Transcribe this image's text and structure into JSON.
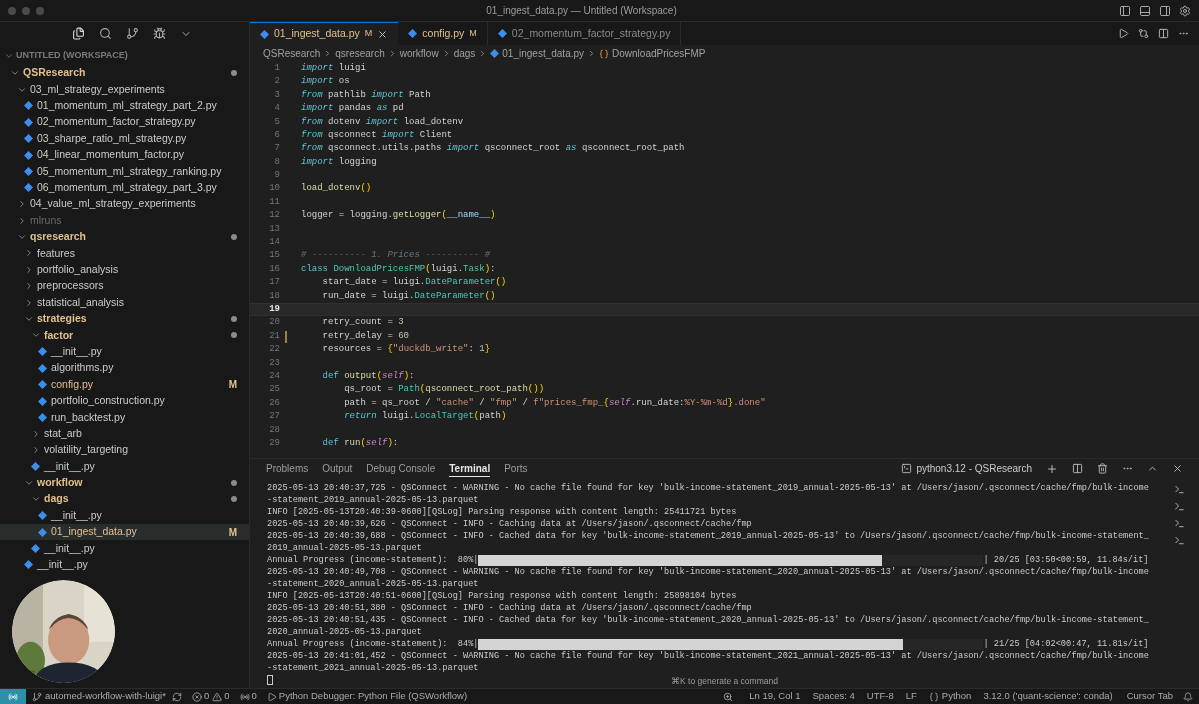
{
  "window": {
    "title": "01_ingest_data.py — Untitled (Workspace)"
  },
  "sidebar": {
    "workspace": "UNTITLED (WORKSPACE)",
    "tree": [
      {
        "name": "QSResearch",
        "kind": "folder",
        "expanded": true,
        "modified": true,
        "ignored": false,
        "selected": false,
        "children": [
          {
            "name": "03_ml_strategy_experiments",
            "kind": "folder",
            "expanded": true,
            "modified": false,
            "ignored": false,
            "selected": false,
            "children": [
              {
                "name": "01_momentum_ml_strategy_part_2.py",
                "kind": "file",
                "modified": false,
                "ignored": false,
                "selected": false
              },
              {
                "name": "02_momentum_factor_strategy.py",
                "kind": "file",
                "modified": false,
                "ignored": false,
                "selected": false
              },
              {
                "name": "03_sharpe_ratio_ml_strategy.py",
                "kind": "file",
                "modified": false,
                "ignored": false,
                "selected": false
              },
              {
                "name": "04_linear_momentum_factor.py",
                "kind": "file",
                "modified": false,
                "ignored": false,
                "selected": false
              },
              {
                "name": "05_momentum_ml_strategy_ranking.py",
                "kind": "file",
                "modified": false,
                "ignored": false,
                "selected": false
              },
              {
                "name": "06_momentum_ml_strategy_part_3.py",
                "kind": "file",
                "modified": false,
                "ignored": false,
                "selected": false
              }
            ]
          },
          {
            "name": "04_value_ml_strategy_experiments",
            "kind": "folder",
            "expanded": false,
            "modified": false,
            "ignored": false,
            "selected": false
          },
          {
            "name": "mlruns",
            "kind": "folder",
            "expanded": false,
            "modified": false,
            "ignored": true,
            "selected": false
          },
          {
            "name": "qsresearch",
            "kind": "folder",
            "expanded": true,
            "modified": true,
            "ignored": false,
            "selected": false,
            "children": [
              {
                "name": "features",
                "kind": "folder",
                "expanded": false,
                "modified": false,
                "ignored": false,
                "selected": false
              },
              {
                "name": "portfolio_analysis",
                "kind": "folder",
                "expanded": false,
                "modified": false,
                "ignored": false,
                "selected": false
              },
              {
                "name": "preprocessors",
                "kind": "folder",
                "expanded": false,
                "modified": false,
                "ignored": false,
                "selected": false
              },
              {
                "name": "statistical_analysis",
                "kind": "folder",
                "expanded": false,
                "modified": false,
                "ignored": false,
                "selected": false
              },
              {
                "name": "strategies",
                "kind": "folder",
                "expanded": true,
                "modified": true,
                "ignored": false,
                "selected": false,
                "children": [
                  {
                    "name": "factor",
                    "kind": "folder",
                    "expanded": true,
                    "modified": true,
                    "ignored": false,
                    "selected": false,
                    "children": [
                      {
                        "name": "__init__.py",
                        "kind": "file",
                        "modified": false,
                        "ignored": false,
                        "selected": false
                      },
                      {
                        "name": "algorithms.py",
                        "kind": "file",
                        "modified": false,
                        "ignored": false,
                        "selected": false
                      },
                      {
                        "name": "config.py",
                        "kind": "file",
                        "modified": true,
                        "ignored": false,
                        "badge": "M",
                        "selected": false
                      },
                      {
                        "name": "portfolio_construction.py",
                        "kind": "file",
                        "modified": false,
                        "ignored": false,
                        "selected": false
                      },
                      {
                        "name": "run_backtest.py",
                        "kind": "file",
                        "modified": false,
                        "ignored": false,
                        "selected": false
                      }
                    ]
                  },
                  {
                    "name": "stat_arb",
                    "kind": "folder",
                    "expanded": false,
                    "modified": false,
                    "ignored": false,
                    "selected": false
                  },
                  {
                    "name": "volatility_targeting",
                    "kind": "folder",
                    "expanded": false,
                    "modified": false,
                    "ignored": false,
                    "selected": false
                  },
                  {
                    "name": "__init__.py",
                    "kind": "file",
                    "modified": false,
                    "ignored": false,
                    "selected": false
                  }
                ]
              },
              {
                "name": "workflow",
                "kind": "folder",
                "expanded": true,
                "modified": true,
                "ignored": false,
                "selected": false,
                "children": [
                  {
                    "name": "dags",
                    "kind": "folder",
                    "expanded": true,
                    "modified": true,
                    "ignored": false,
                    "selected": false,
                    "children": [
                      {
                        "name": "__init__.py",
                        "kind": "file",
                        "modified": false,
                        "ignored": false,
                        "selected": false
                      },
                      {
                        "name": "01_ingest_data.py",
                        "kind": "file",
                        "modified": true,
                        "ignored": false,
                        "badge": "M",
                        "selected": true
                      }
                    ]
                  },
                  {
                    "name": "__init__.py",
                    "kind": "file",
                    "modified": false,
                    "ignored": false,
                    "selected": false
                  }
                ]
              },
              {
                "name": "__init__.py",
                "kind": "file",
                "modified": false,
                "ignored": false,
                "selected": false
              }
            ]
          }
        ]
      }
    ]
  },
  "editor": {
    "tabs": [
      {
        "label": "01_ingest_data.py",
        "badge": "M",
        "modified": true,
        "dimmed": false,
        "selected": true
      },
      {
        "label": "config.py",
        "badge": "M",
        "modified": true,
        "dimmed": false,
        "selected": false
      },
      {
        "label": "02_momentum_factor_strategy.py",
        "modified": false,
        "dimmed": true,
        "selected": false
      }
    ],
    "breadcrumb": [
      "QSResearch",
      "qsresearch",
      "workflow",
      "dags",
      "01_ingest_data.py",
      "DownloadPricesFMP"
    ],
    "lines": [
      {
        "n": "1",
        "current": false,
        "changed": false,
        "tokens": [
          {
            "kind": "kw",
            "t": "import"
          },
          {
            "kind": "plain",
            "t": " luigi"
          }
        ]
      },
      {
        "n": "2",
        "current": false,
        "changed": false,
        "tokens": [
          {
            "kind": "kw",
            "t": "import"
          },
          {
            "kind": "plain",
            "t": " os"
          }
        ]
      },
      {
        "n": "3",
        "current": false,
        "changed": false,
        "tokens": [
          {
            "kind": "kw",
            "t": "from"
          },
          {
            "kind": "plain",
            "t": " pathlib "
          },
          {
            "kind": "kw",
            "t": "import"
          },
          {
            "kind": "plain",
            "t": " Path"
          }
        ]
      },
      {
        "n": "4",
        "current": false,
        "changed": false,
        "tokens": [
          {
            "kind": "kw",
            "t": "import"
          },
          {
            "kind": "plain",
            "t": " pandas "
          },
          {
            "kind": "kw",
            "t": "as"
          },
          {
            "kind": "plain",
            "t": " pd"
          }
        ]
      },
      {
        "n": "5",
        "current": false,
        "changed": false,
        "tokens": [
          {
            "kind": "kw",
            "t": "from"
          },
          {
            "kind": "plain",
            "t": " dotenv "
          },
          {
            "kind": "kw",
            "t": "import"
          },
          {
            "kind": "plain",
            "t": " load_dotenv"
          }
        ]
      },
      {
        "n": "6",
        "current": false,
        "changed": false,
        "tokens": [
          {
            "kind": "kw",
            "t": "from"
          },
          {
            "kind": "plain",
            "t": " qsconnect "
          },
          {
            "kind": "kw",
            "t": "import"
          },
          {
            "kind": "plain",
            "t": " Client"
          }
        ]
      },
      {
        "n": "7",
        "current": false,
        "changed": false,
        "tokens": [
          {
            "kind": "kw",
            "t": "from"
          },
          {
            "kind": "plain",
            "t": " qsconnect.utils.paths "
          },
          {
            "kind": "kw",
            "t": "import"
          },
          {
            "kind": "plain",
            "t": " qsconnect_root "
          },
          {
            "kind": "kw",
            "t": "as"
          },
          {
            "kind": "plain",
            "t": " qsconnect_root_path"
          }
        ]
      },
      {
        "n": "8",
        "current": false,
        "changed": false,
        "tokens": [
          {
            "kind": "kw",
            "t": "import"
          },
          {
            "kind": "plain",
            "t": " logging"
          }
        ]
      },
      {
        "n": "9",
        "current": false,
        "changed": false
      },
      {
        "n": "10",
        "current": false,
        "changed": false,
        "tokens": [
          {
            "kind": "fn",
            "t": "load_dotenv"
          },
          {
            "kind": "br",
            "t": "()"
          }
        ]
      },
      {
        "n": "11",
        "current": false,
        "changed": false
      },
      {
        "n": "12",
        "current": false,
        "changed": false,
        "tokens": [
          {
            "kind": "plain",
            "t": "logger = logging."
          },
          {
            "kind": "fn",
            "t": "getLogger"
          },
          {
            "kind": "br",
            "t": "("
          },
          {
            "kind": "var",
            "t": "__name__"
          },
          {
            "kind": "br",
            "t": ")"
          }
        ]
      },
      {
        "n": "13",
        "current": false,
        "changed": false
      },
      {
        "n": "14",
        "current": false,
        "changed": false
      },
      {
        "n": "15",
        "current": false,
        "changed": false,
        "tokens": [
          {
            "kind": "com",
            "t": "# ---------- 1. Prices ---------- #"
          }
        ]
      },
      {
        "n": "16",
        "current": false,
        "changed": false,
        "tokens": [
          {
            "kind": "kw2",
            "t": "class"
          },
          {
            "kind": "cls",
            "t": " DownloadPricesFMP"
          },
          {
            "kind": "br",
            "t": "("
          },
          {
            "kind": "plain",
            "t": "luigi."
          },
          {
            "kind": "cls",
            "t": "Task"
          },
          {
            "kind": "br",
            "t": ")"
          },
          {
            "kind": "plain",
            "t": ":"
          }
        ]
      },
      {
        "n": "17",
        "current": false,
        "changed": false,
        "tokens": [
          {
            "kind": "plain",
            "t": "    start_date = luigi."
          },
          {
            "kind": "cls",
            "t": "DateParameter"
          },
          {
            "kind": "br",
            "t": "()"
          }
        ]
      },
      {
        "n": "18",
        "current": false,
        "changed": false,
        "tokens": [
          {
            "kind": "plain",
            "t": "    run_date = luigi."
          },
          {
            "kind": "cls",
            "t": "DateParameter"
          },
          {
            "kind": "br",
            "t": "()"
          }
        ]
      },
      {
        "n": "19",
        "current": true,
        "changed": false
      },
      {
        "n": "20",
        "current": false,
        "changed": false,
        "tokens": [
          {
            "kind": "plain",
            "t": "    retry_count = "
          },
          {
            "kind": "num",
            "t": "3"
          }
        ]
      },
      {
        "n": "21",
        "current": false,
        "changed": true,
        "tokens": [
          {
            "kind": "plain",
            "t": "    retry_delay = "
          },
          {
            "kind": "num",
            "t": "60"
          }
        ]
      },
      {
        "n": "22",
        "current": false,
        "changed": false,
        "tokens": [
          {
            "kind": "plain",
            "t": "    resources = "
          },
          {
            "kind": "br",
            "t": "{"
          },
          {
            "kind": "str",
            "t": "\"duckdb_write\""
          },
          {
            "kind": "plain",
            "t": ": "
          },
          {
            "kind": "num",
            "t": "1"
          },
          {
            "kind": "br",
            "t": "}"
          }
        ]
      },
      {
        "n": "23",
        "current": false,
        "changed": false
      },
      {
        "n": "24",
        "current": false,
        "changed": false,
        "tokens": [
          {
            "kind": "kw2",
            "t": "    def"
          },
          {
            "kind": "fn",
            "t": " output"
          },
          {
            "kind": "br",
            "t": "("
          },
          {
            "kind": "self",
            "t": "self"
          },
          {
            "kind": "br",
            "t": ")"
          },
          {
            "kind": "plain",
            "t": ":"
          }
        ]
      },
      {
        "n": "25",
        "current": false,
        "changed": false,
        "tokens": [
          {
            "kind": "plain",
            "t": "        qs_root = "
          },
          {
            "kind": "cls",
            "t": "Path"
          },
          {
            "kind": "br",
            "t": "("
          },
          {
            "kind": "fn",
            "t": "qsconnect_root_path"
          },
          {
            "kind": "br",
            "t": "())"
          }
        ]
      },
      {
        "n": "26",
        "current": false,
        "changed": false,
        "tokens": [
          {
            "kind": "plain",
            "t": "        path = qs_root / "
          },
          {
            "kind": "str",
            "t": "\"cache\""
          },
          {
            "kind": "plain",
            "t": " / "
          },
          {
            "kind": "str",
            "t": "\"fmp\""
          },
          {
            "kind": "plain",
            "t": " / "
          },
          {
            "kind": "str",
            "t": "f\"prices_fmp_"
          },
          {
            "kind": "br",
            "t": "{"
          },
          {
            "kind": "self",
            "t": "self"
          },
          {
            "kind": "plain",
            "t": ".run_date:"
          },
          {
            "kind": "str",
            "t": "%Y-%m-%d"
          },
          {
            "kind": "br",
            "t": "}"
          },
          {
            "kind": "str",
            "t": ".done\""
          }
        ]
      },
      {
        "n": "27",
        "current": false,
        "changed": false,
        "tokens": [
          {
            "kind": "kw",
            "t": "        return"
          },
          {
            "kind": "plain",
            "t": " luigi."
          },
          {
            "kind": "cls",
            "t": "LocalTarget"
          },
          {
            "kind": "br",
            "t": "("
          },
          {
            "kind": "plain",
            "t": "path"
          },
          {
            "kind": "br",
            "t": ")"
          }
        ]
      },
      {
        "n": "28",
        "current": false,
        "changed": false
      },
      {
        "n": "29",
        "current": false,
        "changed": false,
        "tokens": [
          {
            "kind": "kw2",
            "t": "    def"
          },
          {
            "kind": "fn",
            "t": " run"
          },
          {
            "kind": "br",
            "t": "("
          },
          {
            "kind": "self",
            "t": "self"
          },
          {
            "kind": "br",
            "t": ")"
          },
          {
            "kind": "plain",
            "t": ":"
          }
        ]
      }
    ]
  },
  "panel": {
    "tabs": [
      {
        "label": "Problems",
        "selected": false
      },
      {
        "label": "Output",
        "selected": false
      },
      {
        "label": "Debug Console",
        "selected": false
      },
      {
        "label": "Terminal",
        "selected": true
      },
      {
        "label": "Ports",
        "selected": false
      }
    ],
    "terminal_name": "python3.12 - QSResearch",
    "lines": [
      {
        "kind": "text",
        "text": "2025-05-13 20:40:37,725 - QSConnect - WARNING - No cache file found for key 'bulk-income-statement_2019_annual-2025-05-13' at /Users/jason/.qsconnect/cache/fmp/bulk-income"
      },
      {
        "kind": "text",
        "text": "-statement_2019_annual-2025-05-13.parquet"
      },
      {
        "kind": "text",
        "text": "INFO [2025-05-13T20:40:39-0600][QSLog] Parsing response with content length: 25411721 bytes"
      },
      {
        "kind": "text",
        "text": "2025-05-13 20:40:39,626 - QSConnect - INFO - Caching data at /Users/jason/.qsconnect/cache/fmp"
      },
      {
        "kind": "text",
        "text": "2025-05-13 20:40:39,688 - QSConnect - INFO - Cached data for key 'bulk-income-statement_2019_annual-2025-05-13' to /Users/jason/.qsconnect/cache/fmp/bulk-income-statement_"
      },
      {
        "kind": "text",
        "text": "2019_annual-2025-05-13.parquet"
      },
      {
        "kind": "progress",
        "label": "Annual Progress (income-statement):  80%|",
        "level": 0.8,
        "reading": "| 20/25 [03:50<00:59, 11.84s/it]"
      },
      {
        "kind": "text",
        "text": "2025-05-13 20:40:49,708 - QSConnect - WARNING - No cache file found for key 'bulk-income-statement_2020_annual-2025-05-13' at /Users/jason/.qsconnect/cache/fmp/bulk-income"
      },
      {
        "kind": "text",
        "text": "-statement_2020_annual-2025-05-13.parquet"
      },
      {
        "kind": "text",
        "text": "INFO [2025-05-13T20:40:51-0600][QSLog] Parsing response with content length: 25898104 bytes"
      },
      {
        "kind": "text",
        "text": "2025-05-13 20:40:51,380 - QSConnect - INFO - Caching data at /Users/jason/.qsconnect/cache/fmp"
      },
      {
        "kind": "text",
        "text": "2025-05-13 20:40:51,435 - QSConnect - INFO - Cached data for key 'bulk-income-statement_2020_annual-2025-05-13' to /Users/jason/.qsconnect/cache/fmp/bulk-income-statement_"
      },
      {
        "kind": "text",
        "text": "2020_annual-2025-05-13.parquet"
      },
      {
        "kind": "progress",
        "label": "Annual Progress (income-statement):  84%|",
        "level": 0.84,
        "reading": "| 21/25 [04:02<00:47, 11.81s/it]"
      },
      {
        "kind": "text",
        "text": "2025-05-13 20:41:01,452 - QSConnect - WARNING - No cache file found for key 'bulk-income-statement_2021_annual-2025-05-13' at /Users/jason/.qsconnect/cache/fmp/bulk-income"
      },
      {
        "kind": "text",
        "text": "-statement_2021_annual-2025-05-13.parquet"
      },
      {
        "kind": "cursor"
      }
    ]
  },
  "hint": "⌘K to generate a command",
  "status_bar": {
    "branch": "automed-workflow-with-luigi*",
    "errors": "0",
    "warnings": "0",
    "ports": "0",
    "debug_config": "Python Debugger: Python File (QSWorkflow)",
    "items": [
      "Ln 19, Col 1",
      "Spaces: 4",
      "UTF-8",
      "LF"
    ],
    "language": "Python",
    "interpreter": "3.12.0 ('quant-science': conda)",
    "cursor_tab": "Cursor Tab"
  }
}
